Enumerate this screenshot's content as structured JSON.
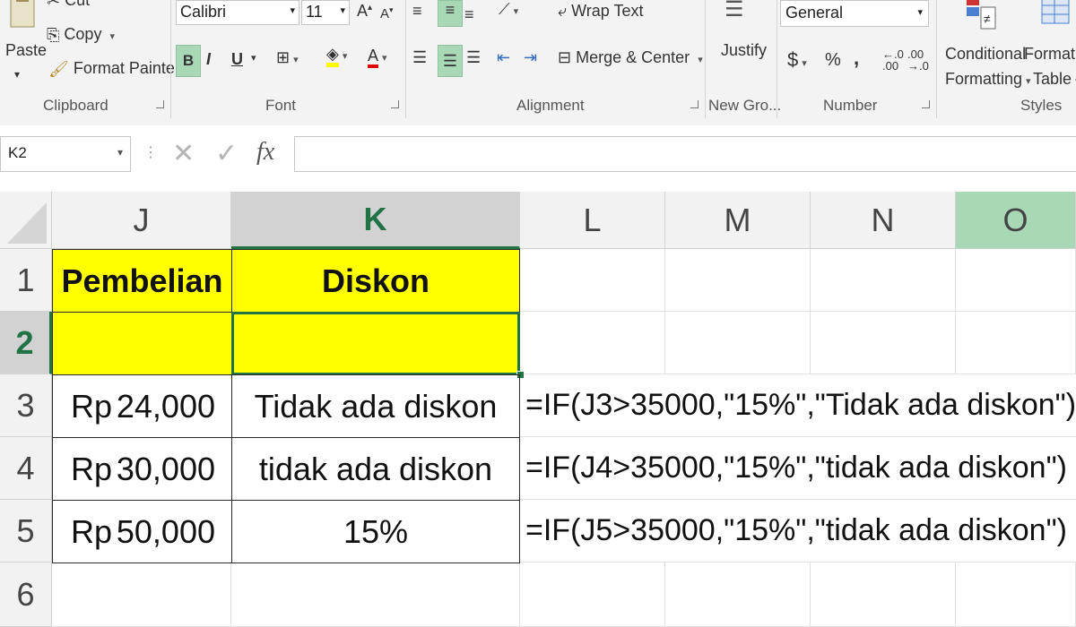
{
  "ribbon": {
    "clipboard": {
      "paste_label": "Paste",
      "cut_label": "Cut",
      "copy_label": "Copy",
      "format_painter_label": "Format Painter",
      "group_label": "Clipboard"
    },
    "font": {
      "font_name": "Calibri",
      "font_size": "11",
      "bold_label": "B",
      "italic_label": "I",
      "underline_label": "U",
      "group_label": "Font"
    },
    "alignment": {
      "wrap_text_label": "Wrap Text",
      "merge_center_label": "Merge & Center",
      "group_label": "Alignment"
    },
    "new_group": {
      "justify_label": "Justify",
      "group_label": "New Gro..."
    },
    "number": {
      "format": "General",
      "currency_symbol": "$",
      "percent_symbol": "%",
      "comma_symbol": ",",
      "group_label": "Number"
    },
    "styles": {
      "conditional_formatting_line1": "Conditional",
      "conditional_formatting_line2": "Formatting",
      "format_as_table_line1": "Format a",
      "format_as_table_line2": "Table",
      "group_label": "Styles"
    }
  },
  "formula_bar": {
    "name_box": "K2",
    "fx_label": "fx",
    "value": ""
  },
  "grid": {
    "columns": [
      "J",
      "K",
      "L",
      "M",
      "N",
      "O"
    ],
    "rows": [
      "1",
      "2",
      "3",
      "4",
      "5",
      "6"
    ],
    "cells": {
      "J1": "Pembelian",
      "K1": "Diskon",
      "J3_currency": "Rp",
      "J3_amount": "24,000",
      "K3": "Tidak ada diskon",
      "L3": "=IF(J3>35000,\"15%\",\"Tidak ada diskon\")",
      "J4_currency": "Rp",
      "J4_amount": "30,000",
      "K4": "tidak ada diskon",
      "L4": "=IF(J4>35000,\"15%\",\"tidak ada diskon\")",
      "J5_currency": "Rp",
      "J5_amount": "50,000",
      "K5": "15%",
      "L5": "=IF(J5>35000,\"15%\",\"tidak ada diskon\")"
    }
  },
  "colors": {
    "highlight_yellow": "#ffff00",
    "selection_green": "#217346",
    "header_selected": "#a9d8b7"
  }
}
